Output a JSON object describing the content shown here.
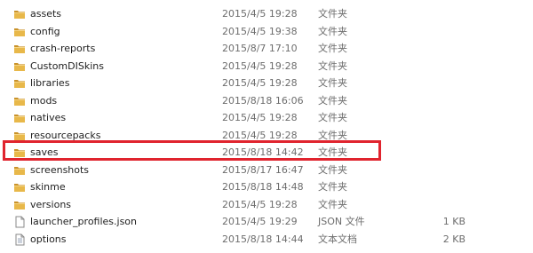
{
  "files": [
    {
      "name": "assets",
      "modified": "2015/4/5 19:28",
      "type": "文件夹",
      "size": "",
      "icon": "folder-icon"
    },
    {
      "name": "config",
      "modified": "2015/4/5 19:38",
      "type": "文件夹",
      "size": "",
      "icon": "folder-icon"
    },
    {
      "name": "crash-reports",
      "modified": "2015/8/7 17:10",
      "type": "文件夹",
      "size": "",
      "icon": "folder-icon"
    },
    {
      "name": "CustomDISkins",
      "modified": "2015/4/5 19:28",
      "type": "文件夹",
      "size": "",
      "icon": "folder-icon"
    },
    {
      "name": "libraries",
      "modified": "2015/4/5 19:28",
      "type": "文件夹",
      "size": "",
      "icon": "folder-icon"
    },
    {
      "name": "mods",
      "modified": "2015/8/18 16:06",
      "type": "文件夹",
      "size": "",
      "icon": "folder-icon"
    },
    {
      "name": "natives",
      "modified": "2015/4/5 19:28",
      "type": "文件夹",
      "size": "",
      "icon": "folder-icon"
    },
    {
      "name": "resourcepacks",
      "modified": "2015/4/5 19:28",
      "type": "文件夹",
      "size": "",
      "icon": "folder-icon"
    },
    {
      "name": "saves",
      "modified": "2015/8/18 14:42",
      "type": "文件夹",
      "size": "",
      "icon": "folder-icon"
    },
    {
      "name": "screenshots",
      "modified": "2015/8/17 16:47",
      "type": "文件夹",
      "size": "",
      "icon": "folder-icon"
    },
    {
      "name": "skinme",
      "modified": "2015/8/18 14:48",
      "type": "文件夹",
      "size": "",
      "icon": "folder-icon"
    },
    {
      "name": "versions",
      "modified": "2015/4/5 19:28",
      "type": "文件夹",
      "size": "",
      "icon": "folder-icon"
    },
    {
      "name": "launcher_profiles.json",
      "modified": "2015/4/5 19:29",
      "type": "JSON 文件",
      "size": "1 KB",
      "icon": "json-file-icon"
    },
    {
      "name": "options",
      "modified": "2015/8/18 14:44",
      "type": "文本文档",
      "size": "2 KB",
      "icon": "text-document-icon"
    }
  ],
  "highlight": {
    "target": "saves",
    "color": "#e0242e"
  },
  "colors": {
    "folder": "#e8b84a",
    "folder_dark": "#c9922a",
    "secondary_text": "#6d6d6d"
  }
}
